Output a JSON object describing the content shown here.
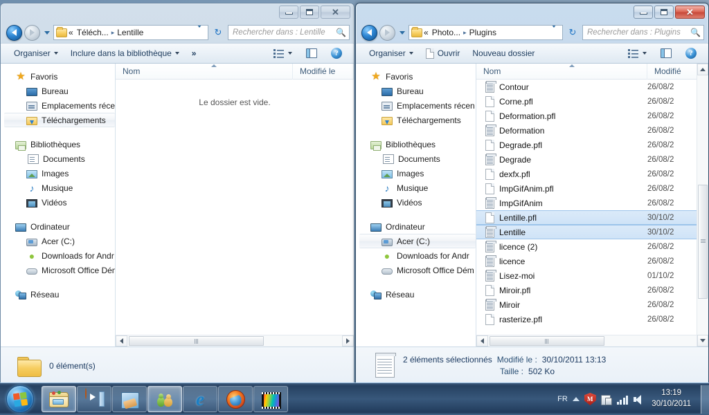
{
  "windows": [
    {
      "id": "left",
      "active": false,
      "titlebar": {
        "minimize": "Réduire",
        "maximize": "Agrandir",
        "close": "Fermer",
        "close_glyph": "✕"
      },
      "address": {
        "breadcrumb_prefix": "«",
        "breadcrumb_parent": "Téléch...",
        "breadcrumb_sep": "▸",
        "breadcrumb_current": "Lentille",
        "refresh_glyph": "↻"
      },
      "search": {
        "placeholder": "Rechercher dans : Lentille",
        "icon": "search-icon"
      },
      "commandbar": {
        "organize": "Organiser",
        "include_library": "Inclure dans la bibliothèque",
        "overflow": "»",
        "views_icon": "views-icon",
        "preview_pane_icon": "preview-pane-icon",
        "help_icon": "help-icon",
        "help_glyph": "?"
      },
      "navpane": {
        "groups": [
          {
            "header": {
              "label": "Favoris",
              "icon": "star-icon"
            },
            "items": [
              {
                "label": "Bureau",
                "icon": "desktop-icon",
                "selected": false
              },
              {
                "label": "Emplacements récen",
                "icon": "recent-places-icon",
                "selected": false
              },
              {
                "label": "Téléchargements",
                "icon": "downloads-icon",
                "selected": true
              }
            ]
          },
          {
            "header": {
              "label": "Bibliothèques",
              "icon": "libraries-icon"
            },
            "items": [
              {
                "label": "Documents",
                "icon": "documents-icon",
                "selected": false
              },
              {
                "label": "Images",
                "icon": "pictures-icon",
                "selected": false
              },
              {
                "label": "Musique",
                "icon": "music-icon",
                "selected": false
              },
              {
                "label": "Vidéos",
                "icon": "videos-icon",
                "selected": false
              }
            ]
          },
          {
            "header": {
              "label": "Ordinateur",
              "icon": "computer-icon"
            },
            "items": [
              {
                "label": "Acer (C:)",
                "icon": "harddrive-icon",
                "selected": false
              },
              {
                "label": "Downloads for Andr",
                "icon": "android-icon",
                "selected": false
              },
              {
                "label": "Microsoft Office Dém",
                "icon": "removable-drive-icon",
                "selected": false
              }
            ]
          },
          {
            "header": {
              "label": "Réseau",
              "icon": "network-icon"
            },
            "items": []
          }
        ]
      },
      "columns": {
        "name": "Nom",
        "modified": "Modifié le"
      },
      "empty_message": "Le dossier est vide.",
      "files": [],
      "statusbar": {
        "icon": "folder-icon",
        "line1": "0 élément(s)"
      }
    },
    {
      "id": "right",
      "active": true,
      "titlebar": {
        "minimize": "Réduire",
        "maximize": "Agrandir",
        "close": "Fermer",
        "close_glyph": "✕"
      },
      "address": {
        "breadcrumb_prefix": "«",
        "breadcrumb_parent": "Photo...",
        "breadcrumb_sep": "▸",
        "breadcrumb_current": "Plugins",
        "refresh_glyph": "↻"
      },
      "search": {
        "placeholder": "Rechercher dans : Plugins",
        "icon": "search-icon"
      },
      "commandbar": {
        "organize": "Organiser",
        "open": "Ouvrir",
        "new_folder": "Nouveau dossier",
        "views_icon": "views-icon",
        "preview_pane_icon": "preview-pane-icon",
        "help_icon": "help-icon",
        "help_glyph": "?"
      },
      "navpane": {
        "groups": [
          {
            "header": {
              "label": "Favoris",
              "icon": "star-icon"
            },
            "items": [
              {
                "label": "Bureau",
                "icon": "desktop-icon",
                "selected": false
              },
              {
                "label": "Emplacements récen",
                "icon": "recent-places-icon",
                "selected": false
              },
              {
                "label": "Téléchargements",
                "icon": "downloads-icon",
                "selected": false
              }
            ]
          },
          {
            "header": {
              "label": "Bibliothèques",
              "icon": "libraries-icon"
            },
            "items": [
              {
                "label": "Documents",
                "icon": "documents-icon",
                "selected": false
              },
              {
                "label": "Images",
                "icon": "pictures-icon",
                "selected": false
              },
              {
                "label": "Musique",
                "icon": "music-icon",
                "selected": false
              },
              {
                "label": "Vidéos",
                "icon": "videos-icon",
                "selected": false
              }
            ]
          },
          {
            "header": {
              "label": "Ordinateur",
              "icon": "computer-icon"
            },
            "items": [
              {
                "label": "Acer (C:)",
                "icon": "harddrive-icon",
                "selected": true
              },
              {
                "label": "Downloads for Andr",
                "icon": "android-icon",
                "selected": false
              },
              {
                "label": "Microsoft Office Dém",
                "icon": "removable-drive-icon",
                "selected": false
              }
            ]
          },
          {
            "header": {
              "label": "Réseau",
              "icon": "network-icon"
            },
            "items": []
          }
        ]
      },
      "columns": {
        "name": "Nom",
        "modified": "Modifié"
      },
      "empty_message": "",
      "files": [
        {
          "name": "Contour",
          "icon": "text-file-icon",
          "modified": "26/08/2",
          "selected": false
        },
        {
          "name": "Corne.pfl",
          "icon": "blank-file-icon",
          "modified": "26/08/2",
          "selected": false
        },
        {
          "name": "Deformation.pfl",
          "icon": "blank-file-icon",
          "modified": "26/08/2",
          "selected": false
        },
        {
          "name": "Deformation",
          "icon": "text-file-icon",
          "modified": "26/08/2",
          "selected": false
        },
        {
          "name": "Degrade.pfl",
          "icon": "blank-file-icon",
          "modified": "26/08/2",
          "selected": false
        },
        {
          "name": "Degrade",
          "icon": "text-file-icon",
          "modified": "26/08/2",
          "selected": false
        },
        {
          "name": "dexfx.pfl",
          "icon": "blank-file-icon",
          "modified": "26/08/2",
          "selected": false
        },
        {
          "name": "ImpGifAnim.pfl",
          "icon": "blank-file-icon",
          "modified": "26/08/2",
          "selected": false
        },
        {
          "name": "ImpGifAnim",
          "icon": "text-file-icon",
          "modified": "26/08/2",
          "selected": false
        },
        {
          "name": "Lentille.pfl",
          "icon": "blank-file-icon",
          "modified": "30/10/2",
          "selected": true
        },
        {
          "name": "Lentille",
          "icon": "text-file-icon",
          "modified": "30/10/2",
          "selected": true
        },
        {
          "name": "licence (2)",
          "icon": "text-file-icon",
          "modified": "26/08/2",
          "selected": false
        },
        {
          "name": "licence",
          "icon": "text-file-icon",
          "modified": "26/08/2",
          "selected": false
        },
        {
          "name": "Lisez-moi",
          "icon": "text-file-icon",
          "modified": "01/10/2",
          "selected": false
        },
        {
          "name": "Miroir.pfl",
          "icon": "blank-file-icon",
          "modified": "26/08/2",
          "selected": false
        },
        {
          "name": "Miroir",
          "icon": "text-file-icon",
          "modified": "26/08/2",
          "selected": false
        },
        {
          "name": "rasterize.pfl",
          "icon": "blank-file-icon",
          "modified": "26/08/2",
          "selected": false
        }
      ],
      "statusbar": {
        "icon": "text-file-icon",
        "selection_count": "2 éléments sélectionnés",
        "modified_label": "Modifié le :",
        "modified_value": "30/10/2011 13:13",
        "size_label": "Taille :",
        "size_value": "502 Ko"
      }
    }
  ],
  "taskbar": {
    "start_button": "Démarrer",
    "items": [
      {
        "name": "windows-explorer",
        "icon": "explorer-icon",
        "state": "pinned-active"
      },
      {
        "name": "windows-media-player",
        "icon": "wmp-icon",
        "state": "running"
      },
      {
        "name": "paint-program",
        "icon": "paint-icon",
        "state": "running"
      },
      {
        "name": "windows-live-messenger",
        "icon": "messenger-icon",
        "state": "pinned-active"
      },
      {
        "name": "internet-explorer",
        "icon": "ie-icon",
        "state": "running"
      },
      {
        "name": "firefox",
        "icon": "firefox-icon",
        "state": "running"
      },
      {
        "name": "photo-filtre",
        "icon": "photofiltre-icon",
        "state": "running"
      }
    ],
    "tray": {
      "language": "FR",
      "show_hidden_icon": "chevron-up-icon",
      "antivirus_icon": "mcafee-shield-icon",
      "antivirus_glyph": "M",
      "action_center_icon": "action-center-icon",
      "network_icon": "network-signal-icon",
      "volume_icon": "volume-icon",
      "time": "13:19",
      "date": "30/10/2011"
    }
  }
}
